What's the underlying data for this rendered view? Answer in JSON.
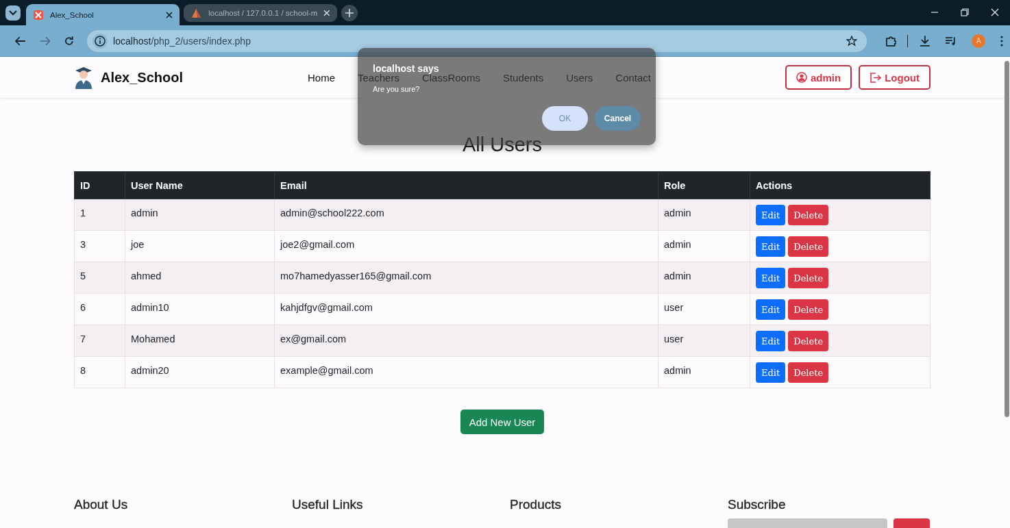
{
  "browser": {
    "tabs": [
      {
        "title": "Alex_School",
        "selected": true
      },
      {
        "title": "localhost / 127.0.0.1 / school-m",
        "selected": false
      }
    ],
    "address": {
      "host": "localhost",
      "path": "/php_2/users/index.php"
    },
    "profile_initial": "A"
  },
  "navbar": {
    "brand": "Alex_School",
    "links": [
      {
        "label": "Home"
      },
      {
        "label": "Teachers"
      },
      {
        "label": "ClassRooms"
      },
      {
        "label": "Students"
      },
      {
        "label": "Users"
      },
      {
        "label": "Contact"
      }
    ],
    "user_button": "admin",
    "logout_button": "Logout"
  },
  "dialog": {
    "title": "localhost says",
    "message": "Are you sure?",
    "buttons": [
      {
        "label": "OK",
        "kind": "primary"
      },
      {
        "label": "Cancel",
        "kind": "secondary"
      }
    ]
  },
  "page_title": "All Users",
  "table": {
    "columns": [
      "ID",
      "User Name",
      "Email",
      "Role",
      "Actions"
    ],
    "rows": [
      {
        "cells": [
          "1",
          "admin",
          "admin@school222.com",
          "admin"
        ],
        "actions": [
          {
            "label": "Edit",
            "kind": "edit"
          },
          {
            "label": "Delete",
            "kind": "delete"
          }
        ]
      },
      {
        "cells": [
          "3",
          "joe",
          "joe2@gmail.com",
          "admin"
        ],
        "actions": [
          {
            "label": "Edit",
            "kind": "edit"
          },
          {
            "label": "Delete",
            "kind": "delete"
          }
        ]
      },
      {
        "cells": [
          "5",
          "ahmed",
          "mo7hamedyasser165@gmail.com",
          "admin"
        ],
        "actions": [
          {
            "label": "Edit",
            "kind": "edit"
          },
          {
            "label": "Delete",
            "kind": "delete"
          }
        ]
      },
      {
        "cells": [
          "6",
          "admin10",
          "kahjdfgv@gmail.com",
          "user"
        ],
        "actions": [
          {
            "label": "Edit",
            "kind": "edit"
          },
          {
            "label": "Delete",
            "kind": "delete"
          }
        ]
      },
      {
        "cells": [
          "7",
          "Mohamed",
          "ex@gmail.com",
          "user"
        ],
        "actions": [
          {
            "label": "Edit",
            "kind": "edit"
          },
          {
            "label": "Delete",
            "kind": "delete"
          }
        ]
      },
      {
        "cells": [
          "8",
          "admin20",
          "example@gmail.com",
          "admin"
        ],
        "actions": [
          {
            "label": "Edit",
            "kind": "edit"
          },
          {
            "label": "Delete",
            "kind": "delete"
          }
        ]
      }
    ]
  },
  "add_button": "Add New User",
  "footer": {
    "headings": [
      "About Us",
      "Useful Links",
      "Products",
      "Subscribe"
    ]
  }
}
